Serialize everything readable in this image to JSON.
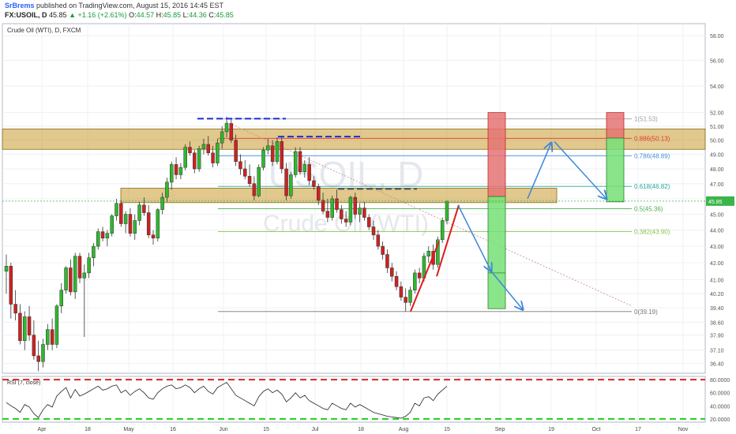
{
  "header": {
    "username": "SrBrems",
    "published": "published on TradingView.com, August 15, 2016 14:45 EST",
    "symbol": "FX:USOIL, D",
    "last": "45.85",
    "change_arrow": "▲",
    "change": "+1.16 (+2.61%)",
    "open_label": "O:",
    "open": "44.57",
    "high_label": "H:",
    "high": "45.85",
    "low_label": "L:",
    "low": "44.36",
    "close_label": "C:",
    "close": "45.85"
  },
  "chart_data": [
    {
      "type": "candlestick",
      "title": "Crude Oil (WTI), D, FXCM",
      "watermark": [
        "USOIL, D",
        "Crude Oil (WTI)"
      ],
      "x_ticks": [
        "Apr",
        "18",
        "May",
        "16",
        "Jun",
        "15",
        "Jul",
        "18",
        "Aug",
        "15",
        "Sep",
        "19",
        "Oct",
        "17",
        "Nov"
      ],
      "y_ticks": [
        "58.00",
        "56.00",
        "54.00",
        "52.00",
        "51.00",
        "50.00",
        "49.00",
        "48.00",
        "47.00",
        "46.00",
        "45.00",
        "44.00",
        "43.00",
        "42.00",
        "41.00",
        "40.20",
        "39.40",
        "38.60",
        "37.90",
        "37.10",
        "36.40"
      ],
      "y_scale": "log",
      "ylim": [
        35.9,
        59.0
      ],
      "grid": true,
      "last_price_label": "45.85",
      "ohlc": [
        [
          41.5,
          42.5,
          40.2,
          41.8
        ],
        [
          41.8,
          42.0,
          38.8,
          39.6
        ],
        [
          39.6,
          40.4,
          38.7,
          39.1
        ],
        [
          39.1,
          39.6,
          37.4,
          37.6
        ],
        [
          37.6,
          39.2,
          37.1,
          38.9
        ],
        [
          38.9,
          39.5,
          37.6,
          37.9
        ],
        [
          37.9,
          38.7,
          36.6,
          36.8
        ],
        [
          36.8,
          37.6,
          36.0,
          36.5
        ],
        [
          36.5,
          37.7,
          36.2,
          37.4
        ],
        [
          37.4,
          38.5,
          37.1,
          38.2
        ],
        [
          38.2,
          38.8,
          37.1,
          37.4
        ],
        [
          37.4,
          39.6,
          37.2,
          39.5
        ],
        [
          39.5,
          40.8,
          39.1,
          40.4
        ],
        [
          40.4,
          41.8,
          40.2,
          41.7
        ],
        [
          41.7,
          42.2,
          40.1,
          40.3
        ],
        [
          40.3,
          42.6,
          39.9,
          42.4
        ],
        [
          42.4,
          42.6,
          40.8,
          41.1
        ],
        [
          41.1,
          41.9,
          37.8,
          41.4
        ],
        [
          41.4,
          42.6,
          41.1,
          42.3
        ],
        [
          42.3,
          43.2,
          41.8,
          43.0
        ],
        [
          43.0,
          44.1,
          42.8,
          43.9
        ],
        [
          43.9,
          44.2,
          43.3,
          43.5
        ],
        [
          43.5,
          44.0,
          43.0,
          43.8
        ],
        [
          43.8,
          45.0,
          43.6,
          44.9
        ],
        [
          44.9,
          46.0,
          44.6,
          45.7
        ],
        [
          45.7,
          45.9,
          44.2,
          44.4
        ],
        [
          44.4,
          45.2,
          43.8,
          45.0
        ],
        [
          45.0,
          45.4,
          43.6,
          43.8
        ],
        [
          43.8,
          45.0,
          43.4,
          44.6
        ],
        [
          44.6,
          45.8,
          44.3,
          45.6
        ],
        [
          45.6,
          46.1,
          44.9,
          45.1
        ],
        [
          45.1,
          45.6,
          43.5,
          43.7
        ],
        [
          43.7,
          44.0,
          43.1,
          43.5
        ],
        [
          43.5,
          45.4,
          43.3,
          45.3
        ],
        [
          45.3,
          46.4,
          45.0,
          46.1
        ],
        [
          46.1,
          47.4,
          45.8,
          47.1
        ],
        [
          47.1,
          48.5,
          46.6,
          48.3
        ],
        [
          48.3,
          48.8,
          47.3,
          47.6
        ],
        [
          47.6,
          48.4,
          47.3,
          48.1
        ],
        [
          48.1,
          49.7,
          47.9,
          49.5
        ],
        [
          49.5,
          49.9,
          48.9,
          49.1
        ],
        [
          49.1,
          49.3,
          47.7,
          48.0
        ],
        [
          48.0,
          49.6,
          47.8,
          49.4
        ],
        [
          49.4,
          50.1,
          49.0,
          49.7
        ],
        [
          49.7,
          50.3,
          48.9,
          49.1
        ],
        [
          49.1,
          49.6,
          48.1,
          48.4
        ],
        [
          48.4,
          50.1,
          48.2,
          49.8
        ],
        [
          49.8,
          51.0,
          49.4,
          50.6
        ],
        [
          50.6,
          51.7,
          50.2,
          51.2
        ],
        [
          51.2,
          51.5,
          49.8,
          50.0
        ],
        [
          50.0,
          50.4,
          48.2,
          48.5
        ],
        [
          48.5,
          49.0,
          47.6,
          48.0
        ],
        [
          48.0,
          48.6,
          47.3,
          47.5
        ],
        [
          47.5,
          48.3,
          46.8,
          47.0
        ],
        [
          47.0,
          47.5,
          45.9,
          46.2
        ],
        [
          46.2,
          48.3,
          46.1,
          48.1
        ],
        [
          48.1,
          49.5,
          47.9,
          49.3
        ],
        [
          49.3,
          50.1,
          49.0,
          49.6
        ],
        [
          49.6,
          50.0,
          48.2,
          48.5
        ],
        [
          48.5,
          50.2,
          48.3,
          49.9
        ],
        [
          49.9,
          50.2,
          47.7,
          48.0
        ],
        [
          48.0,
          48.4,
          45.9,
          46.2
        ],
        [
          46.2,
          47.8,
          46.0,
          47.6
        ],
        [
          47.6,
          49.5,
          47.4,
          49.2
        ],
        [
          49.2,
          49.5,
          47.6,
          47.8
        ],
        [
          47.8,
          48.6,
          47.4,
          48.3
        ],
        [
          48.3,
          48.8,
          46.9,
          47.2
        ],
        [
          47.2,
          47.5,
          46.6,
          46.8
        ],
        [
          46.8,
          47.0,
          45.6,
          45.9
        ],
        [
          45.9,
          46.4,
          45.0,
          45.2
        ],
        [
          45.2,
          46.0,
          44.5,
          44.8
        ],
        [
          44.8,
          46.2,
          44.6,
          46.0
        ],
        [
          46.0,
          46.6,
          45.1,
          45.3
        ],
        [
          45.3,
          45.6,
          44.4,
          44.7
        ],
        [
          44.7,
          45.2,
          44.2,
          44.5
        ],
        [
          44.5,
          46.2,
          44.3,
          46.1
        ],
        [
          46.1,
          46.4,
          44.7,
          45.0
        ],
        [
          45.0,
          45.7,
          44.5,
          45.4
        ],
        [
          45.4,
          45.8,
          44.6,
          44.8
        ],
        [
          44.8,
          45.0,
          44.0,
          44.2
        ],
        [
          44.2,
          44.6,
          43.4,
          43.7
        ],
        [
          43.7,
          44.0,
          42.8,
          43.0
        ],
        [
          43.0,
          43.3,
          42.2,
          42.5
        ],
        [
          42.5,
          42.8,
          41.4,
          41.7
        ],
        [
          41.7,
          42.0,
          40.9,
          41.2
        ],
        [
          41.2,
          41.5,
          40.4,
          40.6
        ],
        [
          40.6,
          40.9,
          39.8,
          40.0
        ],
        [
          40.0,
          40.5,
          39.2,
          39.7
        ],
        [
          39.7,
          40.6,
          39.5,
          40.4
        ],
        [
          40.4,
          41.6,
          40.2,
          41.4
        ],
        [
          41.4,
          41.7,
          40.8,
          41.1
        ],
        [
          41.1,
          42.6,
          40.9,
          42.4
        ],
        [
          42.4,
          43.0,
          42.0,
          42.7
        ],
        [
          42.7,
          43.1,
          41.6,
          41.9
        ],
        [
          41.9,
          43.6,
          41.7,
          43.4
        ],
        [
          43.4,
          44.8,
          43.2,
          44.6
        ],
        [
          44.6,
          45.85,
          44.36,
          45.85
        ]
      ],
      "levels": [
        {
          "label": "1(51.53)",
          "value": 51.53,
          "color": "#9e9e9e"
        },
        {
          "label": "0.886(50.13)",
          "value": 50.13,
          "color": "#e53935"
        },
        {
          "label": "0.786(48.89)",
          "value": 48.89,
          "color": "#4a90d9"
        },
        {
          "label": "0.618(46.82)",
          "value": 46.82,
          "color": "#26a69a"
        },
        {
          "label": "0.5(45.36)",
          "value": 45.36,
          "color": "#4caf50"
        },
        {
          "label": "0.382(43.90)",
          "value": 43.9,
          "color": "#8bc34a"
        },
        {
          "label": "0(39.19)",
          "value": 39.19,
          "color": "#777777"
        }
      ],
      "zones": [
        {
          "from": 49.35,
          "to": 50.8,
          "fill": "#c99a2e"
        },
        {
          "from": 45.75,
          "to": 46.7,
          "fill": "#c99a2e"
        }
      ],
      "target_boxes": [
        {
          "red_top": 52.0,
          "green_top": 46.15,
          "bottom": 39.35
        },
        {
          "red_top": 52.0,
          "green_top": 50.15,
          "bottom": 45.8
        }
      ]
    },
    {
      "type": "line",
      "title": "RSI (7, close)",
      "y_ticks": [
        "80.0000",
        "60.0000",
        "40.0000",
        "20.0000"
      ],
      "ylim": [
        15,
        85
      ],
      "overbought": 80,
      "oversold": 20,
      "values": [
        45,
        40,
        36,
        30,
        42,
        38,
        28,
        22,
        34,
        42,
        38,
        55,
        62,
        68,
        52,
        65,
        55,
        58,
        62,
        66,
        70,
        64,
        66,
        70,
        72,
        60,
        64,
        56,
        62,
        66,
        60,
        52,
        50,
        60,
        66,
        70,
        72,
        66,
        68,
        72,
        68,
        60,
        66,
        70,
        62,
        58,
        68,
        72,
        76,
        66,
        56,
        52,
        48,
        44,
        40,
        54,
        62,
        66,
        60,
        64,
        58,
        46,
        52,
        60,
        52,
        56,
        48,
        44,
        40,
        36,
        34,
        44,
        40,
        36,
        34,
        44,
        38,
        42,
        38,
        34,
        30,
        28,
        26,
        24,
        23,
        22,
        21,
        24,
        30,
        44,
        40,
        52,
        54,
        48,
        58,
        64,
        70
      ]
    }
  ]
}
